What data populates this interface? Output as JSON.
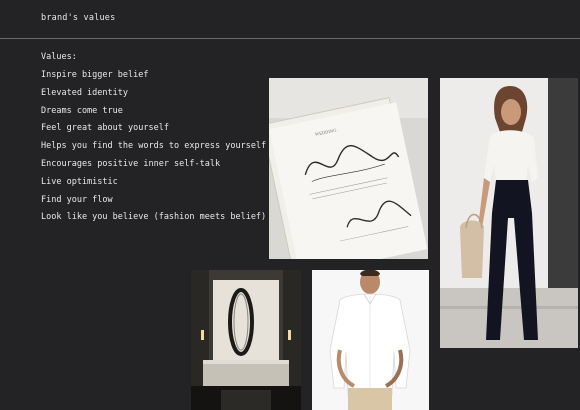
{
  "header": {
    "title": "brand's values"
  },
  "values": {
    "heading": "Values:",
    "items": [
      "Inspire bigger belief",
      "Elevated identity",
      "Dreams come true",
      "Feel great about yourself",
      "Helps you find the words to express yourself",
      "Encourages positive inner self-talk",
      "Live optimistic",
      "Find your flow",
      "Look like you believe (fashion meets belief)"
    ]
  },
  "photos": [
    {
      "icon": "calligraphy-invitation-photo"
    },
    {
      "icon": "woman-in-white-blouse-photo"
    },
    {
      "icon": "interior-lobby-photo"
    },
    {
      "icon": "man-in-white-shirt-photo"
    }
  ]
}
